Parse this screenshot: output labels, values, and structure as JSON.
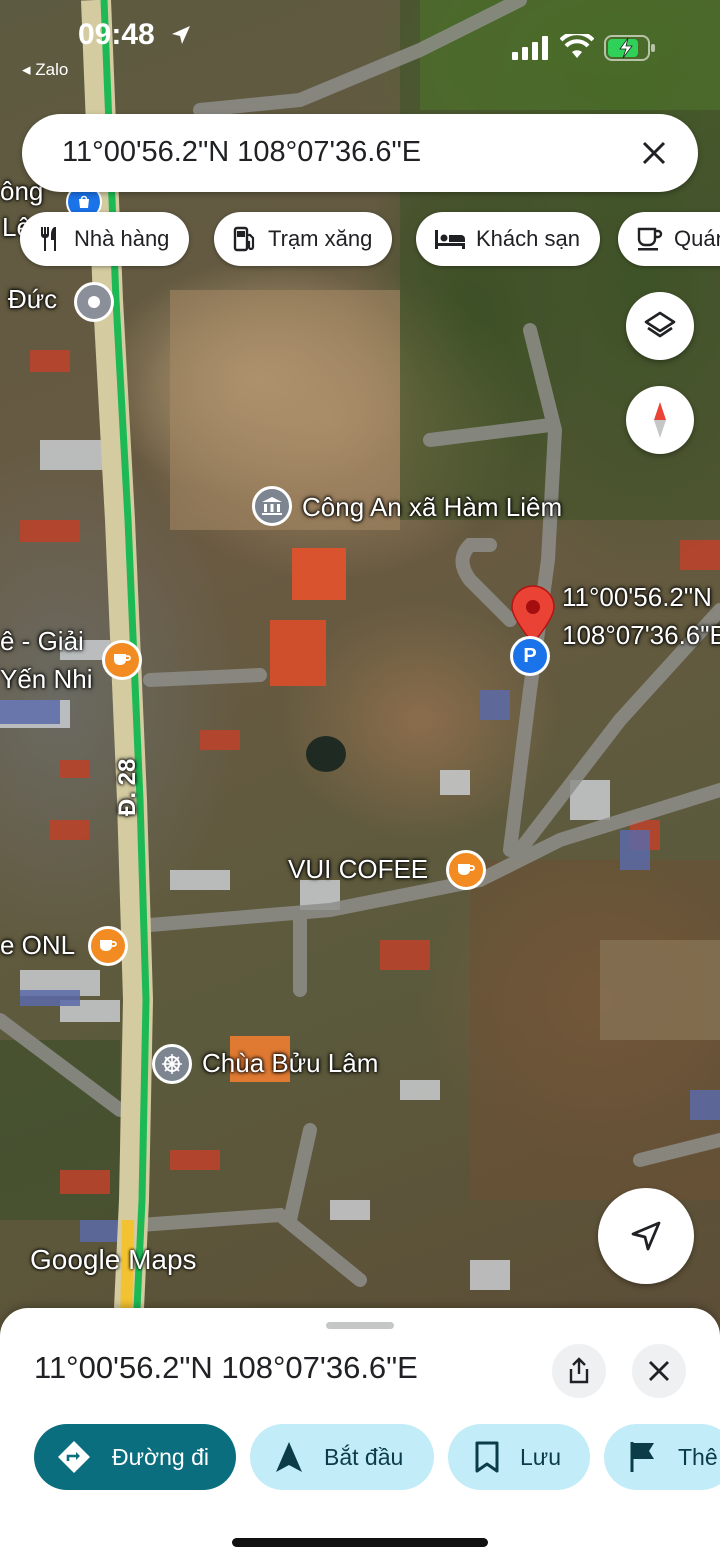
{
  "status_bar": {
    "time": "09:48",
    "back_app": "◂ Zalo"
  },
  "search": {
    "query": "11°00'56.2\"N 108°07'36.6\"E"
  },
  "chips": [
    {
      "label": "Nhà hàng",
      "icon": "restaurant-icon"
    },
    {
      "label": "Trạm xăng",
      "icon": "gas-station-icon"
    },
    {
      "label": "Khách sạn",
      "icon": "hotel-icon"
    },
    {
      "label": "Quán",
      "icon": "cafe-icon"
    }
  ],
  "map": {
    "labels": {
      "top_left_1": "ông",
      "top_left_2": "Lê",
      "duc": "Đức",
      "cong_an": "Công An xã Hàm Liêm",
      "pin_line1": "11°00'56.2\"N",
      "pin_line2": "108°07'36.6\"E",
      "giai_1": "ê - Giải",
      "giai_2": "Yến Nhi",
      "road": "Đ. 28",
      "vui_cofee": "VUI COFEE",
      "onl": "e ONL",
      "chua": "Chùa Bửu Lâm"
    },
    "watermark": "Google Maps",
    "colors": {
      "road_highlight": "#1db954",
      "pin_red": "#ea4335",
      "poi_orange": "#f28b21",
      "poi_gray": "#8a8f99",
      "parking_blue": "#1a73e8"
    }
  },
  "sheet": {
    "title": "11°00'56.2\"N 108°07'36.6\"E",
    "actions": [
      {
        "label": "Đường đi",
        "icon": "directions-icon"
      },
      {
        "label": "Bắt đầu",
        "icon": "navigation-icon"
      },
      {
        "label": "Lưu",
        "icon": "bookmark-icon"
      },
      {
        "label": "Thê",
        "icon": "flag-icon"
      }
    ],
    "colors": {
      "primary": "#0b6e7f",
      "secondary": "#c2ecf7"
    }
  }
}
